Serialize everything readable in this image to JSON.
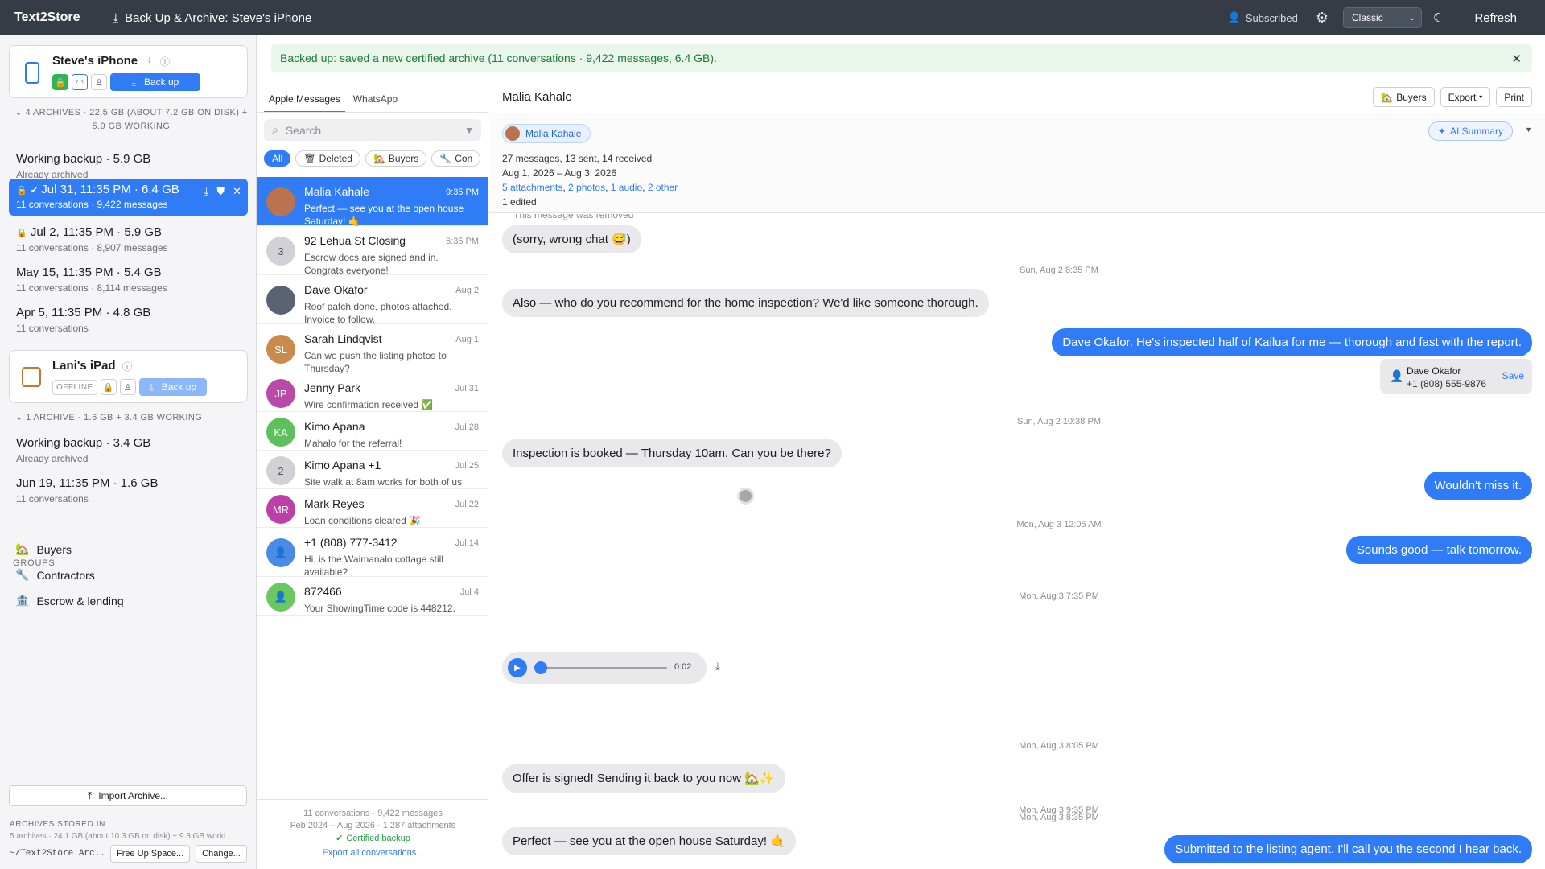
{
  "topbar": {
    "brand": "Text2Store",
    "title": "Back Up & Archive: Steve's iPhone",
    "subscribed": "Subscribed",
    "theme": "Classic",
    "refresh": "Refresh"
  },
  "sidebar": {
    "device1": {
      "name": "Steve's iPhone",
      "backup_label": "Back up"
    },
    "device1_archives_head": "4 ARCHIVES · 22.5 GB (ABOUT 7.2 GB ON DISK) + 5.9 GB WORKING",
    "device1_archives": [
      {
        "title": "Working backup · 5.9 GB",
        "sub": "Already archived"
      },
      {
        "title": "Jul 31, 11:35 PM · 6.4 GB",
        "sub": "11 conversations · 9,422 messages"
      },
      {
        "title": "Jul 2, 11:35 PM · 5.9 GB",
        "sub": "11 conversations · 8,907 messages"
      },
      {
        "title": "May 15, 11:35 PM · 5.4 GB",
        "sub": "11 conversations · 8,114 messages"
      },
      {
        "title": "Apr 5, 11:35 PM · 4.8 GB",
        "sub": "11 conversations"
      }
    ],
    "device2": {
      "name": "Lani's iPad",
      "status": "OFFLINE",
      "backup_label": "Back up"
    },
    "device2_archives_head": "1 ARCHIVE · 1.6 GB + 3.4 GB WORKING",
    "device2_archives": [
      {
        "title": "Working backup · 3.4 GB",
        "sub": "Already archived"
      },
      {
        "title": "Jun 19, 11:35 PM · 1.6 GB",
        "sub": "11 conversations"
      }
    ],
    "groups_title": "GROUPS",
    "groups": [
      "Buyers",
      "Contractors",
      "Escrow & lending"
    ],
    "import_label": "Import Archive...",
    "stored_title": "ARCHIVES STORED IN",
    "stored_sub": "5 archives · 24.1 GB (about 10.3 GB on disk) + 9.3 GB worki...",
    "stored_path": "~/Text2Store Arc...",
    "free_up": "Free Up Space...",
    "change": "Change..."
  },
  "banner": "Backed up: saved a new certified archive (11 conversations · 9,422 messages, 6.4 GB).",
  "convlist": {
    "tabs": [
      "Apple Messages",
      "WhatsApp"
    ],
    "search_placeholder": "Search",
    "chips": [
      "All",
      "Deleted",
      "Buyers",
      "Con"
    ],
    "conversations": [
      {
        "name": "Malia Kahale",
        "date": "9:35 PM",
        "preview": "Perfect — see you at the open house Saturday! 🤙",
        "initials": ""
      },
      {
        "name": "92 Lehua St Closing",
        "date": "6:35 PM",
        "preview": "Escrow docs are signed and in. Congrats everyone!",
        "initials": "3"
      },
      {
        "name": "Dave Okafor",
        "date": "Aug 2",
        "preview": "Roof patch done, photos attached. Invoice to follow.",
        "initials": ""
      },
      {
        "name": "Sarah Lindqvist",
        "date": "Aug 1",
        "preview": "Can we push the listing photos to Thursday?",
        "initials": "SL"
      },
      {
        "name": "Jenny Park",
        "date": "Jul 31",
        "preview": "Wire confirmation received ✅",
        "initials": "JP"
      },
      {
        "name": "Kimo Apana",
        "date": "Jul 28",
        "preview": "Mahalo for the referral!",
        "initials": "KA"
      },
      {
        "name": "Kimo Apana +1",
        "date": "Jul 25",
        "preview": "Site walk at 8am works for both of us",
        "initials": "2"
      },
      {
        "name": "Mark Reyes",
        "date": "Jul 22",
        "preview": "Loan conditions cleared 🎉",
        "initials": "MR"
      },
      {
        "name": "+1 (808) 777-3412",
        "date": "Jul 14",
        "preview": "Hi, is the Waimanalo cottage still available?",
        "initials": ""
      },
      {
        "name": "872466",
        "date": "Jul 4",
        "preview": "Your ShowingTime code is 448212.",
        "initials": ""
      }
    ],
    "footer_line1": "11 conversations · 9,422 messages",
    "footer_line2": "Feb 2024 – Aug 2026 · 1,287 attachments",
    "certified": "Certified backup",
    "export_all": "Export all conversations..."
  },
  "chat": {
    "title": "Malia Kahale",
    "buttons": {
      "buyers": "Buyers",
      "export": "Export",
      "print": "Print"
    },
    "person": "Malia Kahale",
    "stats": "27 messages, 13 sent, 14 received",
    "range": "Aug 1, 2026 – Aug 3, 2026",
    "attachments": {
      "a": "5 attachments",
      "b": "2 photos",
      "c": "1 audio",
      "d": "2 other"
    },
    "edited": "1 edited",
    "ai_summary": "AI Summary",
    "removed_note": "This message was removed",
    "messages": [
      {
        "kind": "in",
        "text": "(sorry, wrong chat 😅)"
      },
      {
        "kind": "ts",
        "text": "Sun, Aug 2 8:35 PM"
      },
      {
        "kind": "in",
        "text": "Also — who do you recommend for the home inspection? We'd like someone thorough."
      },
      {
        "kind": "out",
        "text": "Dave Okafor. He's inspected half of Kailua for me — thorough and fast with the report."
      },
      {
        "kind": "ts",
        "text": "Sun, Aug 2 10:38 PM"
      },
      {
        "kind": "in",
        "text": "Inspection is booked — Thursday 10am. Can you be there?"
      },
      {
        "kind": "out",
        "text": "Wouldn't miss it."
      },
      {
        "kind": "ts",
        "text": "Mon, Aug 3 12:05 AM"
      },
      {
        "kind": "out",
        "text": "Sounds good — talk tomorrow."
      },
      {
        "kind": "ts",
        "text": "Mon, Aug 3 7:35 PM"
      },
      {
        "kind": "ts",
        "text": "Mon, Aug 3 8:05 PM"
      },
      {
        "kind": "in",
        "text": "Offer is signed! Sending it back to you now 🏡✨"
      },
      {
        "kind": "ts",
        "text": "Mon, Aug 3 8:35 PM"
      },
      {
        "kind": "out",
        "text": "Submitted to the listing agent. I'll call you the second I hear back."
      },
      {
        "kind": "ts",
        "text": "Mon, Aug 3 9:35 PM"
      },
      {
        "kind": "in",
        "text": "Perfect — see you at the open house Saturday! 🤙"
      }
    ],
    "contact_card": {
      "name": "Dave Okafor",
      "phone": "+1 (808) 555-9876",
      "save": "Save"
    },
    "audio_duration": "0:02",
    "audio_progress": 0
  }
}
